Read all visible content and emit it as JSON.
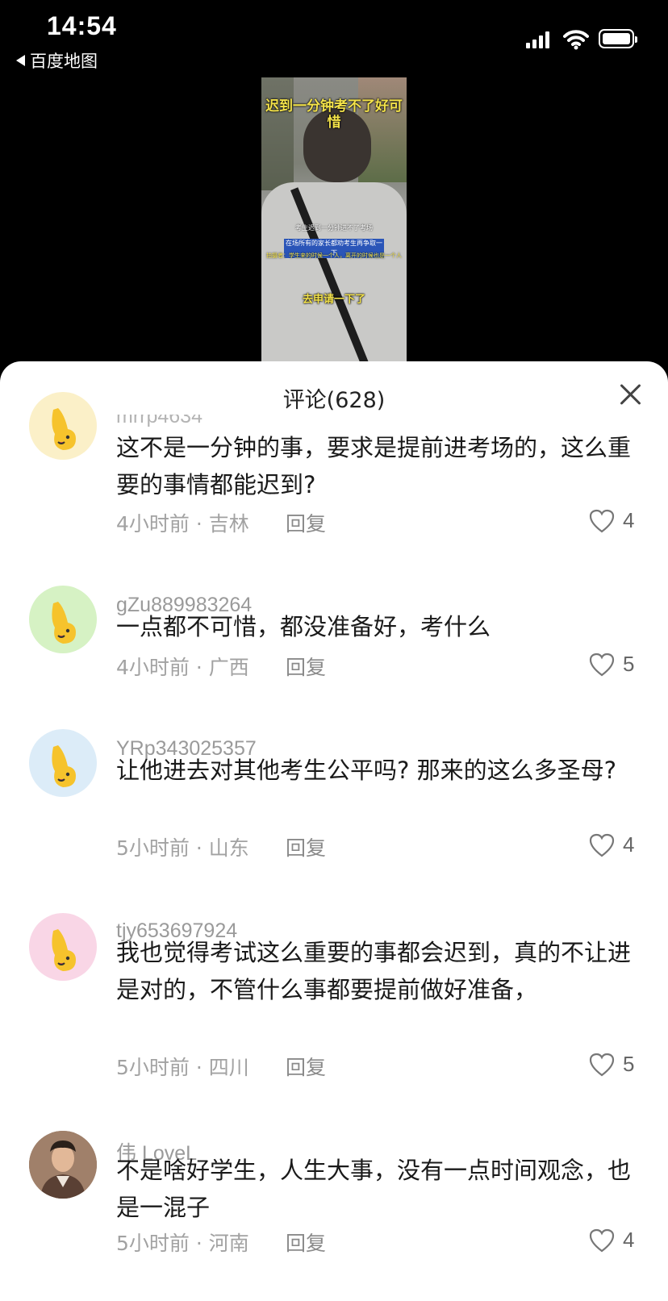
{
  "status_bar": {
    "time": "14:54",
    "back_app": "百度地图"
  },
  "video": {
    "caption_top": "迟到一分钟考不了好可惜",
    "caption_line1": "考生迟到一分钟进不了考场",
    "caption_line2": "在场所有的家长都劝考生再争取一下",
    "caption_line3": "拍摄者：学生来的时候一个人，离开的时候也是一个人",
    "caption_mid": "去申请一下了"
  },
  "comments_panel": {
    "title": "评论(628)",
    "reply_label": "回复",
    "comments": [
      {
        "username": "mrrp4634",
        "text": "这不是一分钟的事，要求是提前进考场的，这么重要的事情都能迟到?",
        "meta": "4小时前 · 吉林",
        "likes": "4",
        "avatar_bg": "#fbf0c8"
      },
      {
        "username": "gZu889983264",
        "text": "一点都不可惜，都没准备好，考什么",
        "meta": "4小时前 · 广西",
        "likes": "5",
        "avatar_bg": "#d6f2c4"
      },
      {
        "username": "YRp343025357",
        "text": "让他进去对其他考生公平吗? 那来的这么多圣母?",
        "meta": "5小时前 · 山东",
        "likes": "4",
        "avatar_bg": "#dcecf8"
      },
      {
        "username": "tjy653697924",
        "text": "我也觉得考试这么重要的事都会迟到，真的不让进是对的，不管什么事都要提前做好准备，",
        "meta": "5小时前 · 四川",
        "likes": "5",
        "avatar_bg": "#f9d6e6"
      },
      {
        "username": "伟 LoveL",
        "text": "不是啥好学生，人生大事，没有一点时间观念，也是一混子",
        "meta": "5小时前 · 河南",
        "likes": "4",
        "avatar_bg": "#8a6a55"
      }
    ]
  }
}
